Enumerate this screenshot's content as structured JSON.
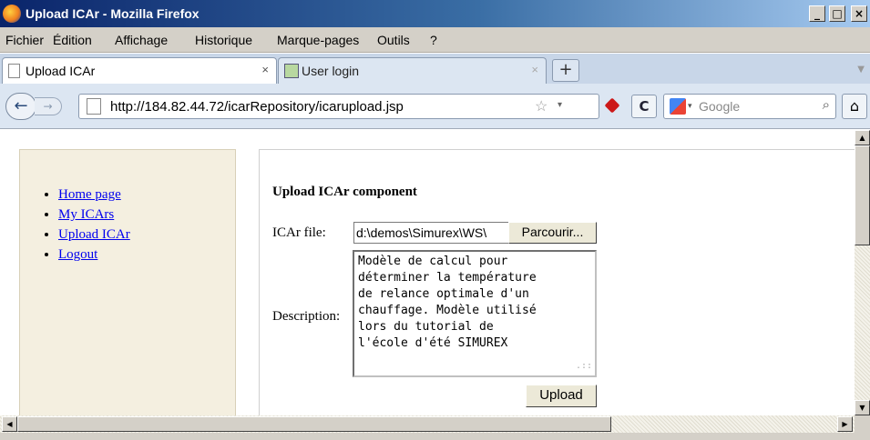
{
  "window": {
    "title": "Upload ICAr - Mozilla Firefox",
    "buttons": {
      "minimize": "_",
      "maximize": "□",
      "close": "×"
    }
  },
  "menu": {
    "items": [
      "Fichier",
      "Édition",
      "Affichage",
      "Historique",
      "Marque-pages",
      "Outils",
      "?"
    ]
  },
  "tabs": [
    {
      "label": "Upload ICAr",
      "close": "×",
      "active": true
    },
    {
      "label": "User login",
      "close": "×",
      "active": false
    }
  ],
  "newtab_label": "+",
  "nav": {
    "url": "http://184.82.44.72/icarRepository/icarupload.jsp",
    "search_placeholder": "Google"
  },
  "sidebar": {
    "links": [
      "Home page",
      "My ICArs",
      "Upload ICAr",
      "Logout"
    ]
  },
  "form": {
    "heading": "Upload ICAr component",
    "file_label": "ICAr file:",
    "file_value": "d:\\demos\\Simurex\\WS\\",
    "browse_label": "Parcourir...",
    "description_label": "Description:",
    "description_lines": [
      "Modèle de calcul pour",
      "déterminer la température",
      "de relance optimale d'un",
      "chauffage. Modèle utilisé",
      "lors du tutorial de",
      "l'école d'été SIMUREX"
    ],
    "upload_label": "Upload"
  }
}
